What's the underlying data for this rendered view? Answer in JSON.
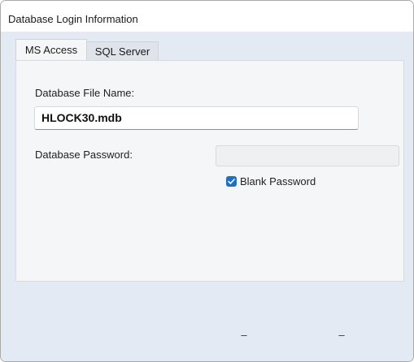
{
  "window": {
    "title": "Database Login Information"
  },
  "tabs": [
    {
      "label": "MS Access",
      "selected": true
    },
    {
      "label": "SQL Server",
      "selected": false
    }
  ],
  "ms_access": {
    "file_name_label": "Database File Name:",
    "file_name_value": "HLOCK30.mdb",
    "password_label": "Database Password:",
    "password_value": "",
    "blank_password_label": "Blank Password",
    "blank_password_checked": true
  },
  "footer": {
    "ok_label": "–",
    "cancel_label": "–"
  },
  "colors": {
    "accent": "#1f6fc4",
    "dialog_background": "#e4eaf3"
  }
}
